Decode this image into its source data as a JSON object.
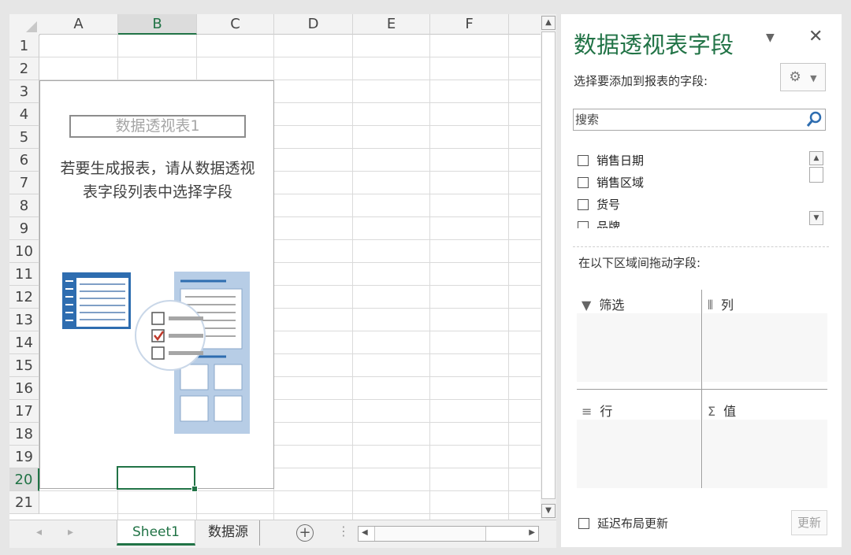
{
  "spreadsheet": {
    "columns": [
      "A",
      "B",
      "C",
      "D",
      "E",
      "F"
    ],
    "selected_column": "B",
    "rows": [
      "1",
      "2",
      "3",
      "4",
      "5",
      "6",
      "7",
      "8",
      "9",
      "10",
      "11",
      "12",
      "13",
      "14",
      "15",
      "16",
      "17",
      "18",
      "19",
      "20",
      "21"
    ],
    "selected_row": "20",
    "pivot_placeholder": {
      "name": "数据透视表1",
      "message_line1": "若要生成报表，请从数据透视",
      "message_line2": "表字段列表中选择字段"
    }
  },
  "sheet_tabs": [
    {
      "label": "Sheet1",
      "active": true
    },
    {
      "label": "数据源",
      "active": false
    }
  ],
  "panel": {
    "title": "数据透视表字段",
    "choose_fields_label": "选择要添加到报表的字段:",
    "search_placeholder": "搜索",
    "fields": [
      {
        "label": "销售日期",
        "checked": false
      },
      {
        "label": "销售区域",
        "checked": false
      },
      {
        "label": "货号",
        "checked": false
      },
      {
        "label": "品牌",
        "checked": false
      }
    ],
    "drag_label": "在以下区域间拖动字段:",
    "areas": {
      "filter": "筛选",
      "columns": "列",
      "rows": "行",
      "values": "值"
    },
    "defer_label": "延迟布局更新",
    "update_button": "更新"
  },
  "icons": {
    "dropdown": "chevron-down-icon",
    "close": "close-icon",
    "gear": "gear-icon",
    "search": "search-icon",
    "filter": "filter-icon",
    "columns": "columns-icon",
    "rows": "rows-icon",
    "values": "sigma-icon",
    "add_sheet": "plus-circle-icon"
  },
  "colors": {
    "accent": "#217346",
    "illustration_blue": "#2e6db0",
    "illustration_light": "#b7cde6",
    "check_red": "#c0392b"
  }
}
